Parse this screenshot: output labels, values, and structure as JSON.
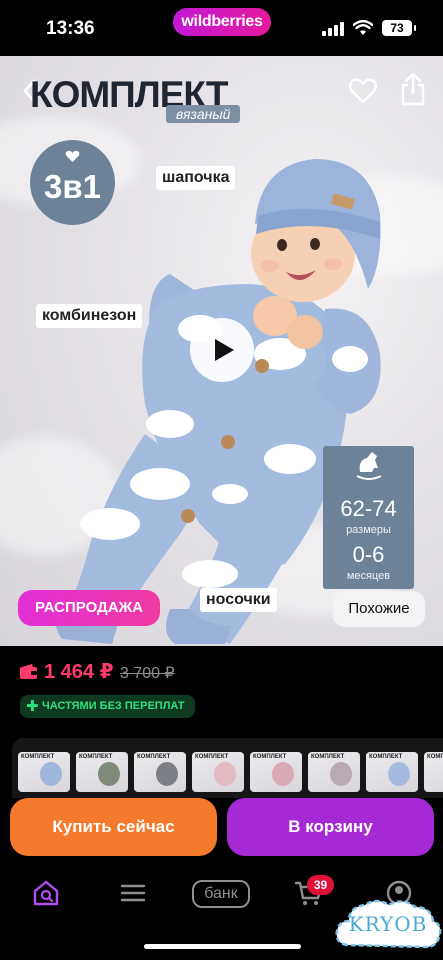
{
  "status_bar": {
    "time": "13:36",
    "app_label": "wildberries",
    "battery": "73"
  },
  "product_photo": {
    "heading": "КОМПЛЕКТ",
    "subheading": "вязаный",
    "badge_3v1": "3в1",
    "label_hat": "шапочка",
    "label_overall": "комбинезон",
    "label_socks": "носочки",
    "sizes": "62-74",
    "sizes_caption": "размеры",
    "months": "0-6",
    "months_caption": "месяцев",
    "sale_badge": "РАСПРОДАЖА",
    "similar_button": "Похожие",
    "thumb_title": "КОМПЛЕКТ"
  },
  "price": {
    "current": "1 464 ₽",
    "old": "3 700 ₽",
    "installment": "ЧАСТЯМИ БЕЗ ПЕРЕПЛАТ"
  },
  "actions": {
    "buy_now": "Купить сейчас",
    "add_to_cart": "В корзину"
  },
  "tabbar": {
    "bank_label": "банк",
    "cart_count": "39"
  },
  "watermark": {
    "text": "KRYOB"
  },
  "colors": {
    "brand_gradient_start": "#c218d6",
    "brand_gradient_end": "#e41a9c",
    "price_red": "#ff3b6b",
    "installment_green": "#2fe07c",
    "buy_now_orange": "#f57a2b",
    "cart_purple": "#a52ad6",
    "knit_blue": "#9fb6dd",
    "accent_slate": "#6d8296"
  },
  "icons": {
    "back": "chevron-left-icon",
    "favorite": "heart-outline-icon",
    "share": "share-icon",
    "play": "play-icon",
    "home": "home-search-icon",
    "catalog": "menu-lines-icon",
    "cart": "cart-icon",
    "profile": "profile-icon"
  }
}
